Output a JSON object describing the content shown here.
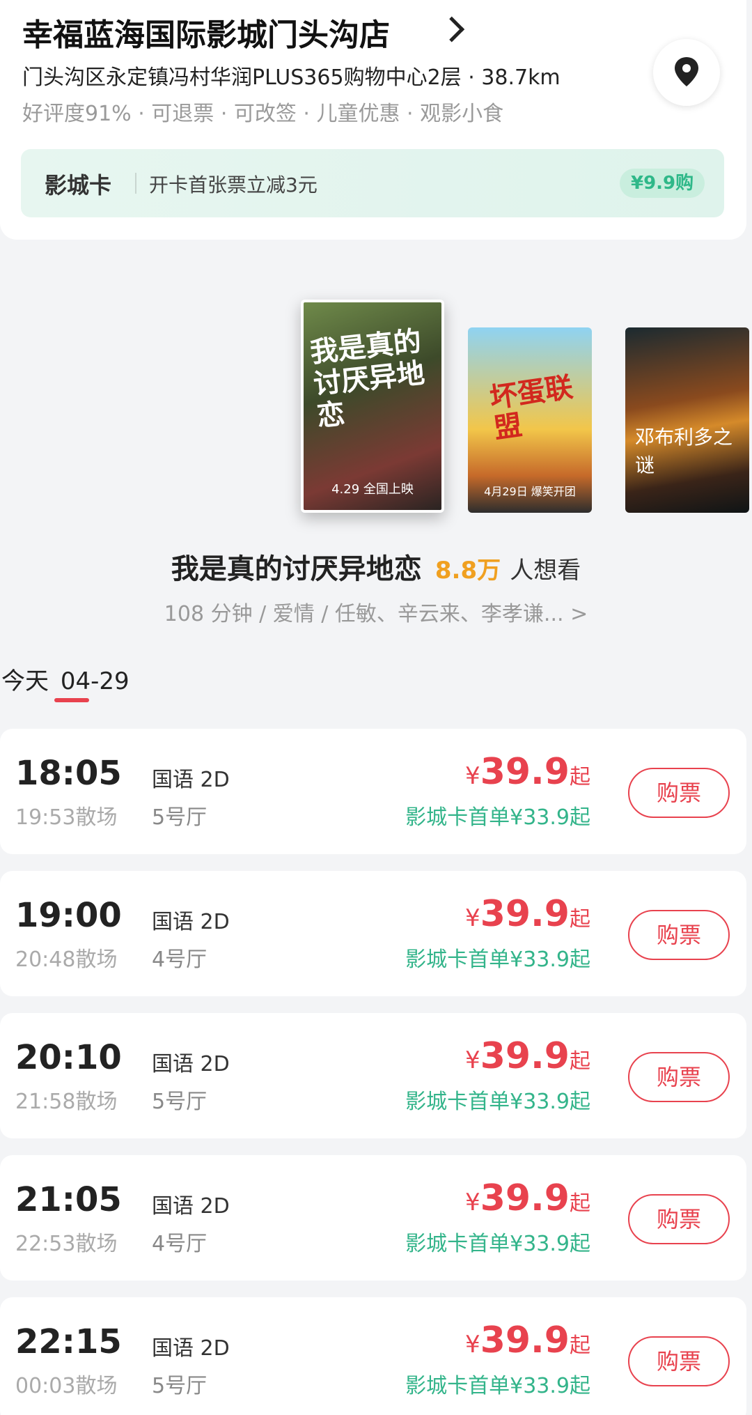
{
  "cinema": {
    "title": "幸福蓝海国际影城门头沟店",
    "address": "门头沟区永定镇冯村华润PLUS365购物中心2层 · 38.7km",
    "tags": "好评度91% · 可退票 · 可改签 · 儿童优惠 · 观影小食",
    "location_icon": "map-pin-icon"
  },
  "card_banner": {
    "name": "影城卡",
    "desc": "开卡首张票立减3元",
    "price": "¥9.9购"
  },
  "posters": {
    "p1_headline": "我是真的讨厌异地恋",
    "p1_date": "4.29 全国上映",
    "p2_headline": "坏蛋联盟",
    "p2_caption": "4月29日 爆笑开团",
    "p3_headline": "邓布利多之谜"
  },
  "movie": {
    "title": "我是真的讨厌异地恋",
    "want_count": "8.8万",
    "want_suffix": "人想看",
    "meta": "108 分钟 / 爱情 / 任敏、辛云来、李孝谦... >"
  },
  "date_tab": {
    "day": "今天",
    "date": "04-29"
  },
  "showtimes": [
    {
      "start": "18:05",
      "end": "19:53散场",
      "lang": "国语 2D",
      "hall": "5号厅",
      "yen": "¥",
      "price": "39.9",
      "qi": "起",
      "card_price": "影城卡首单¥33.9起",
      "buy": "购票"
    },
    {
      "start": "19:00",
      "end": "20:48散场",
      "lang": "国语 2D",
      "hall": "4号厅",
      "yen": "¥",
      "price": "39.9",
      "qi": "起",
      "card_price": "影城卡首单¥33.9起",
      "buy": "购票"
    },
    {
      "start": "20:10",
      "end": "21:58散场",
      "lang": "国语 2D",
      "hall": "5号厅",
      "yen": "¥",
      "price": "39.9",
      "qi": "起",
      "card_price": "影城卡首单¥33.9起",
      "buy": "购票"
    },
    {
      "start": "21:05",
      "end": "22:53散场",
      "lang": "国语 2D",
      "hall": "4号厅",
      "yen": "¥",
      "price": "39.9",
      "qi": "起",
      "card_price": "影城卡首单¥33.9起",
      "buy": "购票"
    },
    {
      "start": "22:15",
      "end": "00:03散场",
      "lang": "国语 2D",
      "hall": "5号厅",
      "yen": "¥",
      "price": "39.9",
      "qi": "起",
      "card_price": "影城卡首单¥33.9起",
      "buy": "购票"
    }
  ],
  "colors": {
    "accent": "#e8424e",
    "card_green": "#33b48a",
    "want_orange": "#f0a020"
  }
}
